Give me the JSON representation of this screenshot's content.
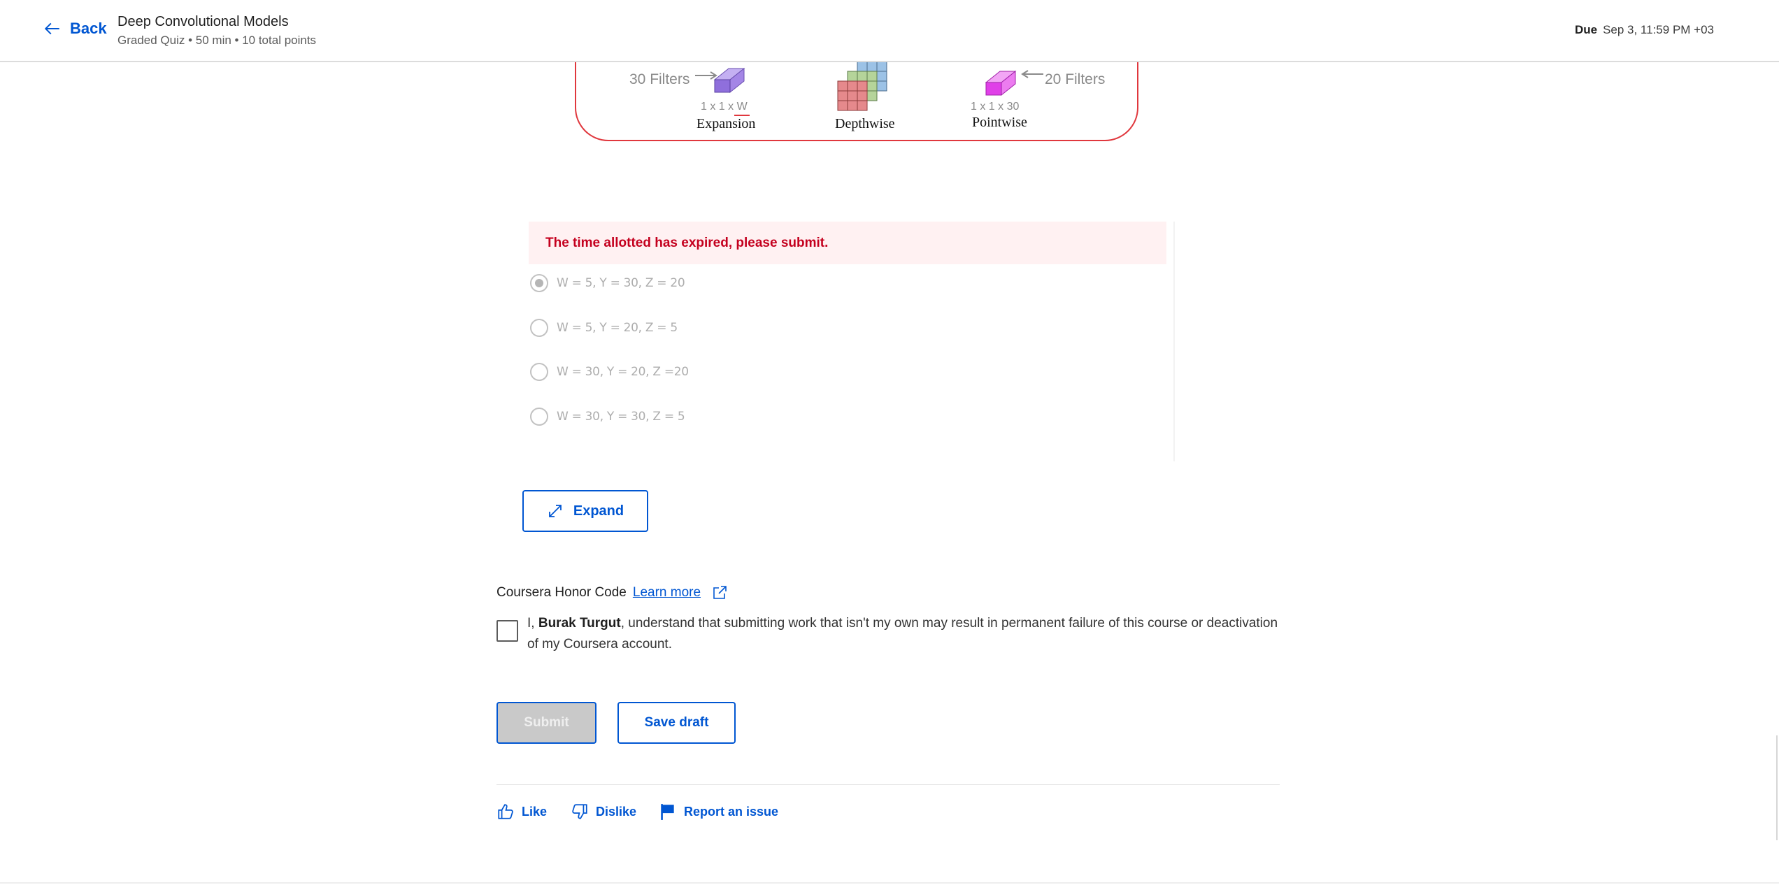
{
  "header": {
    "back_label": "Back",
    "course_title": "Deep Convolutional Models",
    "course_subtitle": "Graded Quiz • 50 min • 10 total points",
    "due_label": "Due",
    "due_value": "Sep 3, 11:59 PM +03"
  },
  "diagram": {
    "left_filters": "30 Filters",
    "right_filters": "20 Filters",
    "expansion_dims": "1 x 1 x W",
    "pointwise_dims": "1 x 1 x 30",
    "stage_labels": [
      "Expansion",
      "Depthwise",
      "Pointwise"
    ],
    "colors": {
      "expansion": "#9b7fe0",
      "depthwise_red": "#e5898c",
      "depthwise_green": "#b5d49a",
      "depthwise_blue": "#9cc2e6",
      "pointwise": "#e040e8",
      "border": "#e0373d"
    }
  },
  "question": {
    "alert": "The time allotted has expired, please submit.",
    "options": [
      {
        "label": "W = 5, Y = 30, Z = 20",
        "selected": true
      },
      {
        "label": "W = 5, Y = 20, Z = 5",
        "selected": false
      },
      {
        "label": "W = 30, Y = 20, Z =20",
        "selected": false
      },
      {
        "label": "W = 30, Y = 30, Z = 5",
        "selected": false
      }
    ],
    "expand_label": "Expand"
  },
  "honor": {
    "title": "Coursera Honor Code",
    "learn_more": "Learn more",
    "statement_prefix": "I, ",
    "user_name": "Burak Turgut",
    "statement_rest": ", understand that submitting work that isn't my own may result in permanent failure of this course or deactivation of my Coursera account."
  },
  "actions": {
    "submit": "Submit",
    "save_draft": "Save draft"
  },
  "feedback": {
    "like": "Like",
    "dislike": "Dislike",
    "report": "Report an issue"
  },
  "icons": [
    "arrow-left-icon",
    "expand-icon",
    "external-link-icon",
    "thumbs-up-icon",
    "thumbs-down-icon",
    "flag-icon"
  ],
  "accent_color": "#0056d2",
  "alert_color": "#c4001e"
}
